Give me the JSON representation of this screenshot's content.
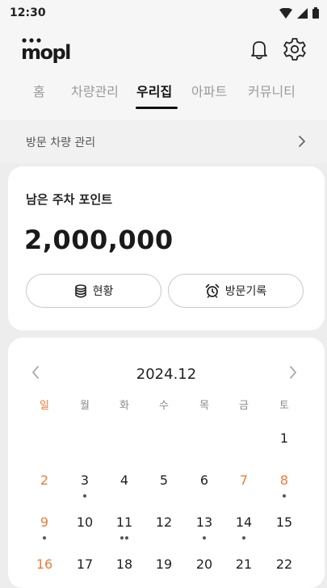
{
  "status_bar": {
    "time": "12:30"
  },
  "header": {
    "logo_text": "mopl",
    "tabs": [
      {
        "label": "홈",
        "active": false
      },
      {
        "label": "차량관리",
        "active": false
      },
      {
        "label": "우리집",
        "active": true
      },
      {
        "label": "아파트",
        "active": false
      },
      {
        "label": "커뮤니티",
        "active": false
      }
    ]
  },
  "visit_management": {
    "label": "방문 차량 관리"
  },
  "points_card": {
    "title": "남은 주차 포인트",
    "value": "2,000,000",
    "status_button": "현황",
    "history_button": "방문기록"
  },
  "calendar": {
    "title": "2024.12",
    "weekdays": [
      "일",
      "월",
      "화",
      "수",
      "목",
      "금",
      "토"
    ],
    "rows": [
      [
        {
          "d": ""
        },
        {
          "d": ""
        },
        {
          "d": ""
        },
        {
          "d": ""
        },
        {
          "d": ""
        },
        {
          "d": ""
        },
        {
          "d": "1",
          "dots": 0,
          "red": false
        }
      ],
      [
        {
          "d": "2",
          "dots": 0,
          "red": true
        },
        {
          "d": "3",
          "dots": 1,
          "red": false
        },
        {
          "d": "4",
          "dots": 0,
          "red": false
        },
        {
          "d": "5",
          "dots": 0,
          "red": false
        },
        {
          "d": "6",
          "dots": 0,
          "red": false
        },
        {
          "d": "7",
          "dots": 0,
          "red": true
        },
        {
          "d": "8",
          "dots": 1,
          "red": true
        }
      ],
      [
        {
          "d": "9",
          "dots": 1,
          "red": true
        },
        {
          "d": "10",
          "dots": 0,
          "red": false
        },
        {
          "d": "11",
          "dots": 2,
          "red": false
        },
        {
          "d": "12",
          "dots": 0,
          "red": false
        },
        {
          "d": "13",
          "dots": 1,
          "red": false
        },
        {
          "d": "14",
          "dots": 1,
          "red": false
        },
        {
          "d": "15",
          "dots": 0,
          "red": false
        }
      ],
      [
        {
          "d": "16",
          "dots": 0,
          "red": true
        },
        {
          "d": "17",
          "dots": 0,
          "red": false
        },
        {
          "d": "18",
          "dots": 0,
          "red": false
        },
        {
          "d": "19",
          "dots": 0,
          "red": false
        },
        {
          "d": "20",
          "dots": 0,
          "red": false
        },
        {
          "d": "21",
          "dots": 0,
          "red": false
        },
        {
          "d": "22",
          "dots": 0,
          "red": false
        }
      ]
    ]
  },
  "colors": {
    "accent": "#f07a35",
    "text": "#1f1f1f",
    "muted": "#9a9a9a"
  },
  "icons": [
    "wifi-icon",
    "signal-icon",
    "battery-icon",
    "bell-icon",
    "gear-icon",
    "chevron-right-icon",
    "database-icon",
    "alarm-clock-icon",
    "chevron-left-icon"
  ]
}
